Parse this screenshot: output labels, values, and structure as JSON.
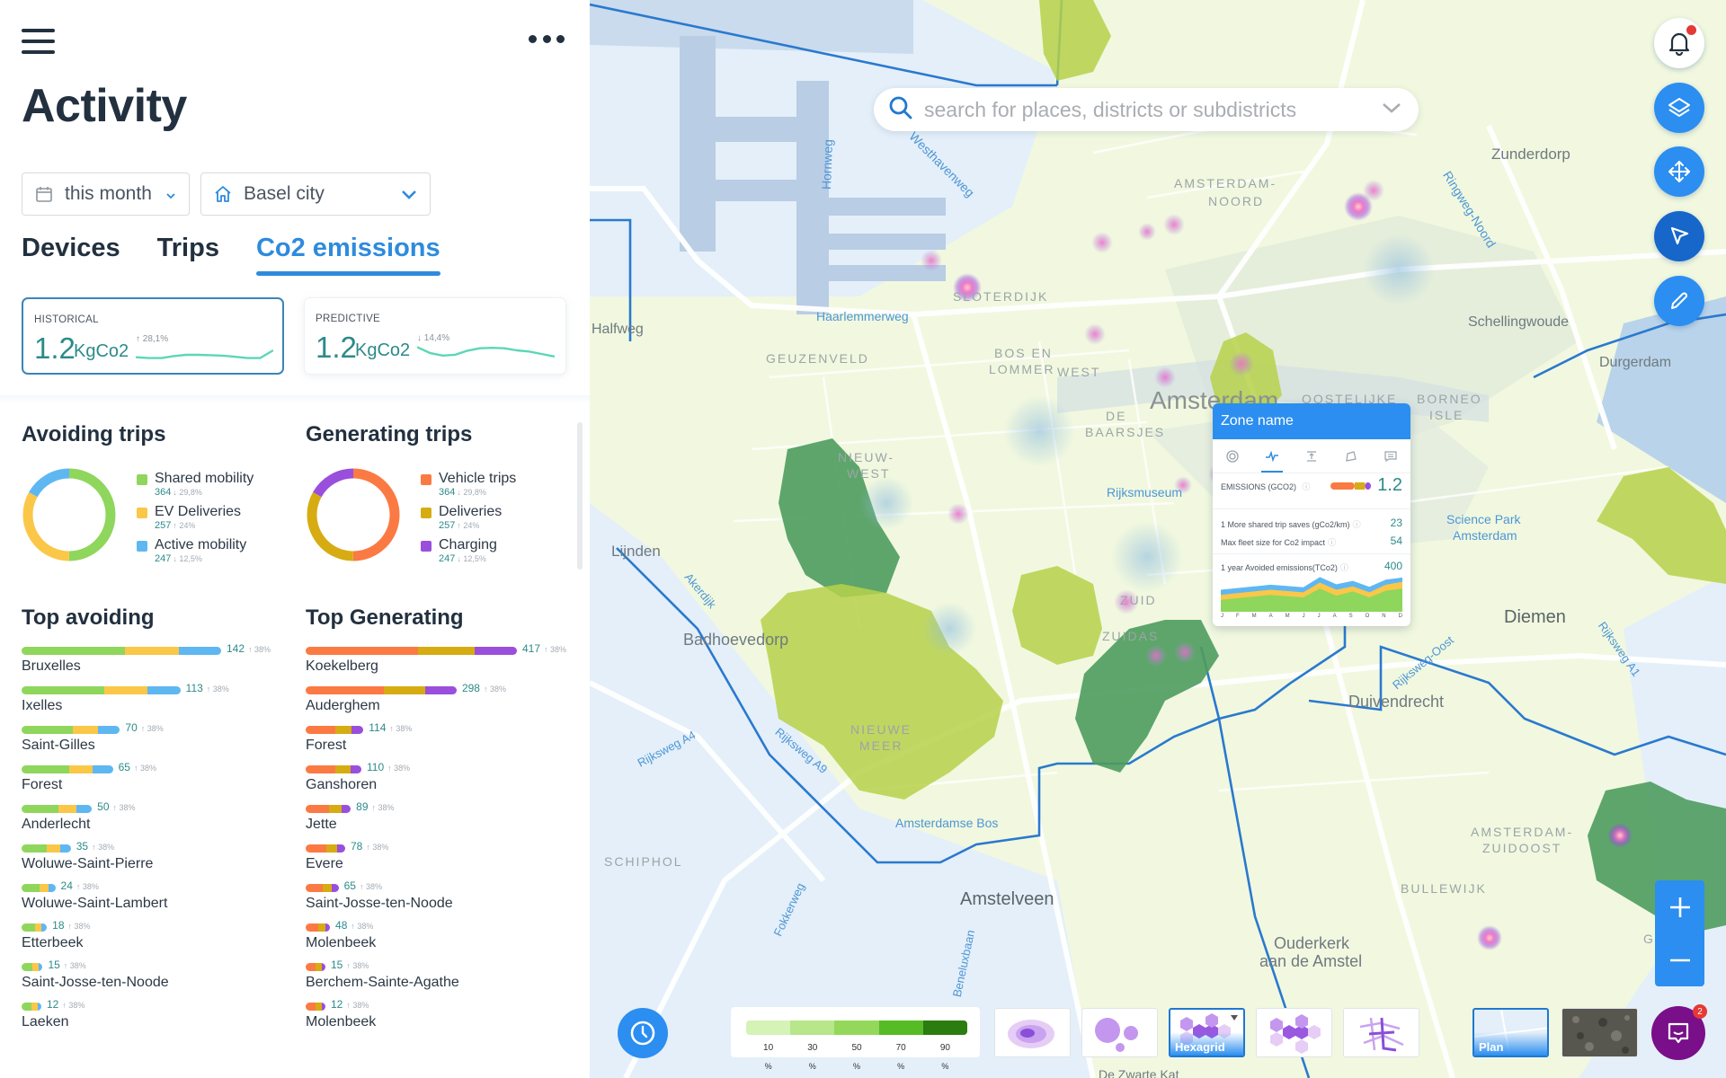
{
  "sidebar": {
    "title": "Activity",
    "filters": {
      "date": {
        "value": "this month",
        "icon": "calendar-icon"
      },
      "city": {
        "value": "Basel city",
        "icon": "home-icon"
      }
    },
    "tabs": [
      {
        "label": "Devices",
        "active": false
      },
      {
        "label": "Trips",
        "active": false
      },
      {
        "label": "Co2 emissions",
        "active": true
      }
    ],
    "kpis": [
      {
        "label": "HISTORICAL",
        "value": "1.2",
        "unit": "KgCo2",
        "delta": "↑ 28,1%",
        "trend": [
          0.35,
          0.3,
          0.3,
          0.42,
          0.5,
          0.5,
          0.48,
          0.45,
          0.38,
          0.3,
          0.3,
          0.75
        ],
        "selected": true
      },
      {
        "label": "PREDICTIVE",
        "value": "1.2",
        "unit": "KgCo2",
        "delta": "↓ 14,4%",
        "trend": [
          0.9,
          0.55,
          0.4,
          0.45,
          0.7,
          0.85,
          0.88,
          0.85,
          0.72,
          0.65,
          0.5,
          0.35
        ],
        "selected": false
      }
    ],
    "avoiding": {
      "title": "Avoiding trips",
      "items": [
        {
          "name": "Shared mobility",
          "value": "364",
          "delta": "↓ 29,8%",
          "color": "#8fd65d",
          "share": 0.5
        },
        {
          "name": "EV Deliveries",
          "value": "257",
          "delta": "↑ 24%",
          "color": "#fbc748",
          "share": 0.33
        },
        {
          "name": "Active mobility",
          "value": "247",
          "delta": "↓ 12,5%",
          "color": "#5fb7f2",
          "share": 0.17
        }
      ]
    },
    "generating": {
      "title": "Generating trips",
      "items": [
        {
          "name": "Vehicle trips",
          "value": "364",
          "delta": "↓ 29,8%",
          "color": "#fb7a43",
          "share": 0.5
        },
        {
          "name": "Deliveries",
          "value": "257",
          "delta": "↑ 24%",
          "color": "#d6ac12",
          "share": 0.33
        },
        {
          "name": "Charging",
          "value": "247",
          "delta": "↓ 12,5%",
          "color": "#9a4fdc",
          "share": 0.17
        }
      ]
    },
    "top_avoiding": {
      "title": "Top avoiding",
      "colors": [
        "#8fd65d",
        "#fbc748",
        "#5fb7f2"
      ],
      "rows": [
        {
          "city": "Bruxelles",
          "value": 142,
          "delta": "↑ 38%",
          "split": [
            0.52,
            0.27,
            0.21
          ]
        },
        {
          "city": "Ixelles",
          "value": 113,
          "delta": "↑ 38%",
          "split": [
            0.52,
            0.27,
            0.21
          ]
        },
        {
          "city": "Saint-Gilles",
          "value": 70,
          "delta": "↑ 38%",
          "split": [
            0.52,
            0.26,
            0.22
          ]
        },
        {
          "city": "Forest",
          "value": 65,
          "delta": "↑ 38%",
          "split": [
            0.52,
            0.26,
            0.22
          ]
        },
        {
          "city": "Anderlecht",
          "value": 50,
          "delta": "↑ 38%",
          "split": [
            0.52,
            0.26,
            0.22
          ]
        },
        {
          "city": "Woluwe-Saint-Pierre",
          "value": 35,
          "delta": "↑ 38%",
          "split": [
            0.52,
            0.27,
            0.21
          ]
        },
        {
          "city": "Woluwe-Saint-Lambert",
          "value": 24,
          "delta": "↑ 38%",
          "split": [
            0.52,
            0.28,
            0.2
          ]
        },
        {
          "city": "Etterbeek",
          "value": 18,
          "delta": "↑ 38%",
          "split": [
            0.52,
            0.27,
            0.21
          ]
        },
        {
          "city": "Saint-Josse-ten-Noode",
          "value": 15,
          "delta": "↑ 38%",
          "split": [
            0.52,
            0.28,
            0.2
          ]
        },
        {
          "city": "Laeken",
          "value": 12,
          "delta": "↑ 38%",
          "split": [
            0.52,
            0.28,
            0.2
          ]
        }
      ]
    },
    "top_generating": {
      "title": "Top Generating",
      "colors": [
        "#fb7a43",
        "#d6ac12",
        "#9a4fdc"
      ],
      "rows": [
        {
          "city": "Koekelberg",
          "value": 417,
          "delta": "↑ 38%",
          "split": [
            0.53,
            0.27,
            0.2
          ]
        },
        {
          "city": "Auderghem",
          "value": 298,
          "delta": "↑ 38%",
          "split": [
            0.52,
            0.27,
            0.21
          ]
        },
        {
          "city": "Forest",
          "value": 114,
          "delta": "↑ 38%",
          "split": [
            0.52,
            0.27,
            0.21
          ]
        },
        {
          "city": "Ganshoren",
          "value": 110,
          "delta": "↑ 38%",
          "split": [
            0.53,
            0.27,
            0.2
          ]
        },
        {
          "city": "Jette",
          "value": 89,
          "delta": "↑ 38%",
          "split": [
            0.52,
            0.27,
            0.21
          ]
        },
        {
          "city": "Evere",
          "value": 78,
          "delta": "↑ 38%",
          "split": [
            0.52,
            0.27,
            0.21
          ]
        },
        {
          "city": "Saint-Josse-ten-Noode",
          "value": 65,
          "delta": "↑ 38%",
          "split": [
            0.52,
            0.28,
            0.2
          ]
        },
        {
          "city": "Molenbeek",
          "value": 48,
          "delta": "↑ 38%",
          "split": [
            0.52,
            0.28,
            0.2
          ]
        },
        {
          "city": "Berchem-Sainte-Agathe",
          "value": 15,
          "delta": "↑ 38%",
          "split": [
            0.5,
            0.3,
            0.2
          ]
        },
        {
          "city": "Molenbeek",
          "value": 12,
          "delta": "↑ 38%",
          "split": [
            0.5,
            0.3,
            0.2
          ]
        }
      ]
    }
  },
  "map": {
    "search": {
      "placeholder": "search for places, districts or subdistricts",
      "value": ""
    },
    "labels": [
      {
        "text": "Amsterdam",
        "type": "city-large"
      },
      {
        "text": "Badhoevedorp",
        "type": "city"
      },
      {
        "text": "Diemen",
        "type": "city"
      },
      {
        "text": "Duivendrecht",
        "type": "city"
      },
      {
        "text": "Amstelveen",
        "type": "city"
      },
      {
        "text": "Ouderkerk",
        "type": "city"
      },
      {
        "text": "aan de Amstel",
        "type": "city"
      },
      {
        "text": "Lijnden",
        "type": "town"
      },
      {
        "text": "Zunderdorp",
        "type": "town"
      },
      {
        "text": "Schellingwoude",
        "type": "town"
      },
      {
        "text": "Durgerdam",
        "type": "town"
      },
      {
        "text": "Halfweg",
        "type": "town"
      },
      {
        "text": "Science Park",
        "type": "town"
      },
      {
        "text": "Amsterdam",
        "type": "town"
      },
      {
        "text": "AMSTERDAM-",
        "type": "district"
      },
      {
        "text": "NOORD",
        "type": "district"
      },
      {
        "text": "SLOTERDIJK",
        "type": "district"
      },
      {
        "text": "GEUZENVELD",
        "type": "district"
      },
      {
        "text": "BOS EN",
        "type": "district"
      },
      {
        "text": "LOMMER",
        "type": "district"
      },
      {
        "text": "WEST",
        "type": "district"
      },
      {
        "text": "DE",
        "type": "district"
      },
      {
        "text": "BAARSJES",
        "type": "district"
      },
      {
        "text": "NIEUW-",
        "type": "district"
      },
      {
        "text": "WEST",
        "type": "district"
      },
      {
        "text": "ZUID",
        "type": "district"
      },
      {
        "text": "ZUIDAS",
        "type": "district"
      },
      {
        "text": "NIEUWE",
        "type": "district"
      },
      {
        "text": "MEER",
        "type": "district"
      },
      {
        "text": "AMSTERDAM-",
        "type": "district"
      },
      {
        "text": "ZUIDOOST",
        "type": "district"
      },
      {
        "text": "BULLEWIJK",
        "type": "district"
      },
      {
        "text": "GEIN",
        "type": "district"
      },
      {
        "text": "SCHIPHOL",
        "type": "district"
      },
      {
        "text": "OOSTELIJKE",
        "type": "district"
      },
      {
        "text": "BORNEO",
        "type": "district"
      },
      {
        "text": "ISLE",
        "type": "district"
      },
      {
        "text": "Hornweg",
        "type": "road"
      },
      {
        "text": "Westhavenweg",
        "type": "road"
      },
      {
        "text": "Haarlemmerweg",
        "type": "road"
      },
      {
        "text": "Ringweg-Noord",
        "type": "road"
      },
      {
        "text": "Akerdijk",
        "type": "road"
      },
      {
        "text": "Rijksweg A4",
        "type": "road"
      },
      {
        "text": "Rijksweg A9",
        "type": "road"
      },
      {
        "text": "Rijksweg-Oost",
        "type": "road"
      },
      {
        "text": "Rijksweg A1",
        "type": "road"
      },
      {
        "text": "Amsterdamse Bos",
        "type": "road"
      },
      {
        "text": "Rijksmuseum",
        "type": "road"
      },
      {
        "text": "Fokkerweg",
        "type": "road"
      },
      {
        "text": "Beneluxbaan",
        "type": "road"
      },
      {
        "text": "De Zwarte Kat",
        "type": "town"
      }
    ],
    "tools": [
      {
        "name": "notifications",
        "icon": "bell-icon",
        "has_alert": true
      },
      {
        "name": "layers",
        "icon": "layers-icon"
      },
      {
        "name": "pan",
        "icon": "move-icon"
      },
      {
        "name": "select",
        "icon": "cursor-arrow-icon",
        "active": true
      },
      {
        "name": "draw",
        "icon": "pencil-icon"
      }
    ],
    "zoom": {
      "in": "+",
      "out": "−"
    },
    "popup": {
      "title": "Zone name",
      "tabs": [
        "gauge-icon",
        "activity-icon",
        "vertical-align-icon",
        "polygon-icon",
        "comment-icon"
      ],
      "active_tab": 1,
      "emissions_label": "EMISSIONS (GCO2)",
      "emissions_value": "1.2",
      "emissions_split": [
        0.6,
        0.25,
        0.15
      ],
      "rows": [
        {
          "label": "1 More shared trip saves (gCo2/km)",
          "value": "23"
        },
        {
          "label": "Max fleet size for Co2 impact",
          "value": "54"
        }
      ],
      "avoided_label": "1 year Avoided emissions(TCo2)",
      "avoided_value": "400",
      "chart": {
        "months": [
          "J",
          "F",
          "M",
          "A",
          "M",
          "J",
          "J",
          "A",
          "S",
          "O",
          "N",
          "D"
        ],
        "green": [
          0.28,
          0.32,
          0.36,
          0.4,
          0.37,
          0.34,
          0.55,
          0.38,
          0.48,
          0.34,
          0.5,
          0.55
        ],
        "yellow": [
          0.12,
          0.12,
          0.12,
          0.12,
          0.12,
          0.12,
          0.14,
          0.14,
          0.12,
          0.12,
          0.14,
          0.16
        ],
        "blue": [
          0.12,
          0.12,
          0.12,
          0.12,
          0.12,
          0.12,
          0.13,
          0.13,
          0.13,
          0.13,
          0.12,
          0.1
        ]
      }
    },
    "legend": {
      "ticks": [
        "10",
        "30",
        "50",
        "70",
        "90"
      ],
      "unit": "%",
      "colors": [
        "#d5f2b7",
        "#b8e68a",
        "#93d85a",
        "#56bb24",
        "#2a7d0e"
      ]
    },
    "layers": [
      {
        "name": "heatmap",
        "label": "",
        "selected": false
      },
      {
        "name": "bubbles",
        "label": "",
        "selected": false
      },
      {
        "name": "hexagrid",
        "label": "Hexagrid",
        "selected": true,
        "has_menu": true
      },
      {
        "name": "hexagrid-alt",
        "label": "",
        "selected": false
      },
      {
        "name": "network",
        "label": "",
        "selected": false
      }
    ],
    "basemaps": [
      {
        "name": "plan",
        "label": "Plan",
        "selected": true
      },
      {
        "name": "satellite",
        "label": "",
        "selected": false
      }
    ],
    "chat": {
      "badge": "2"
    }
  }
}
